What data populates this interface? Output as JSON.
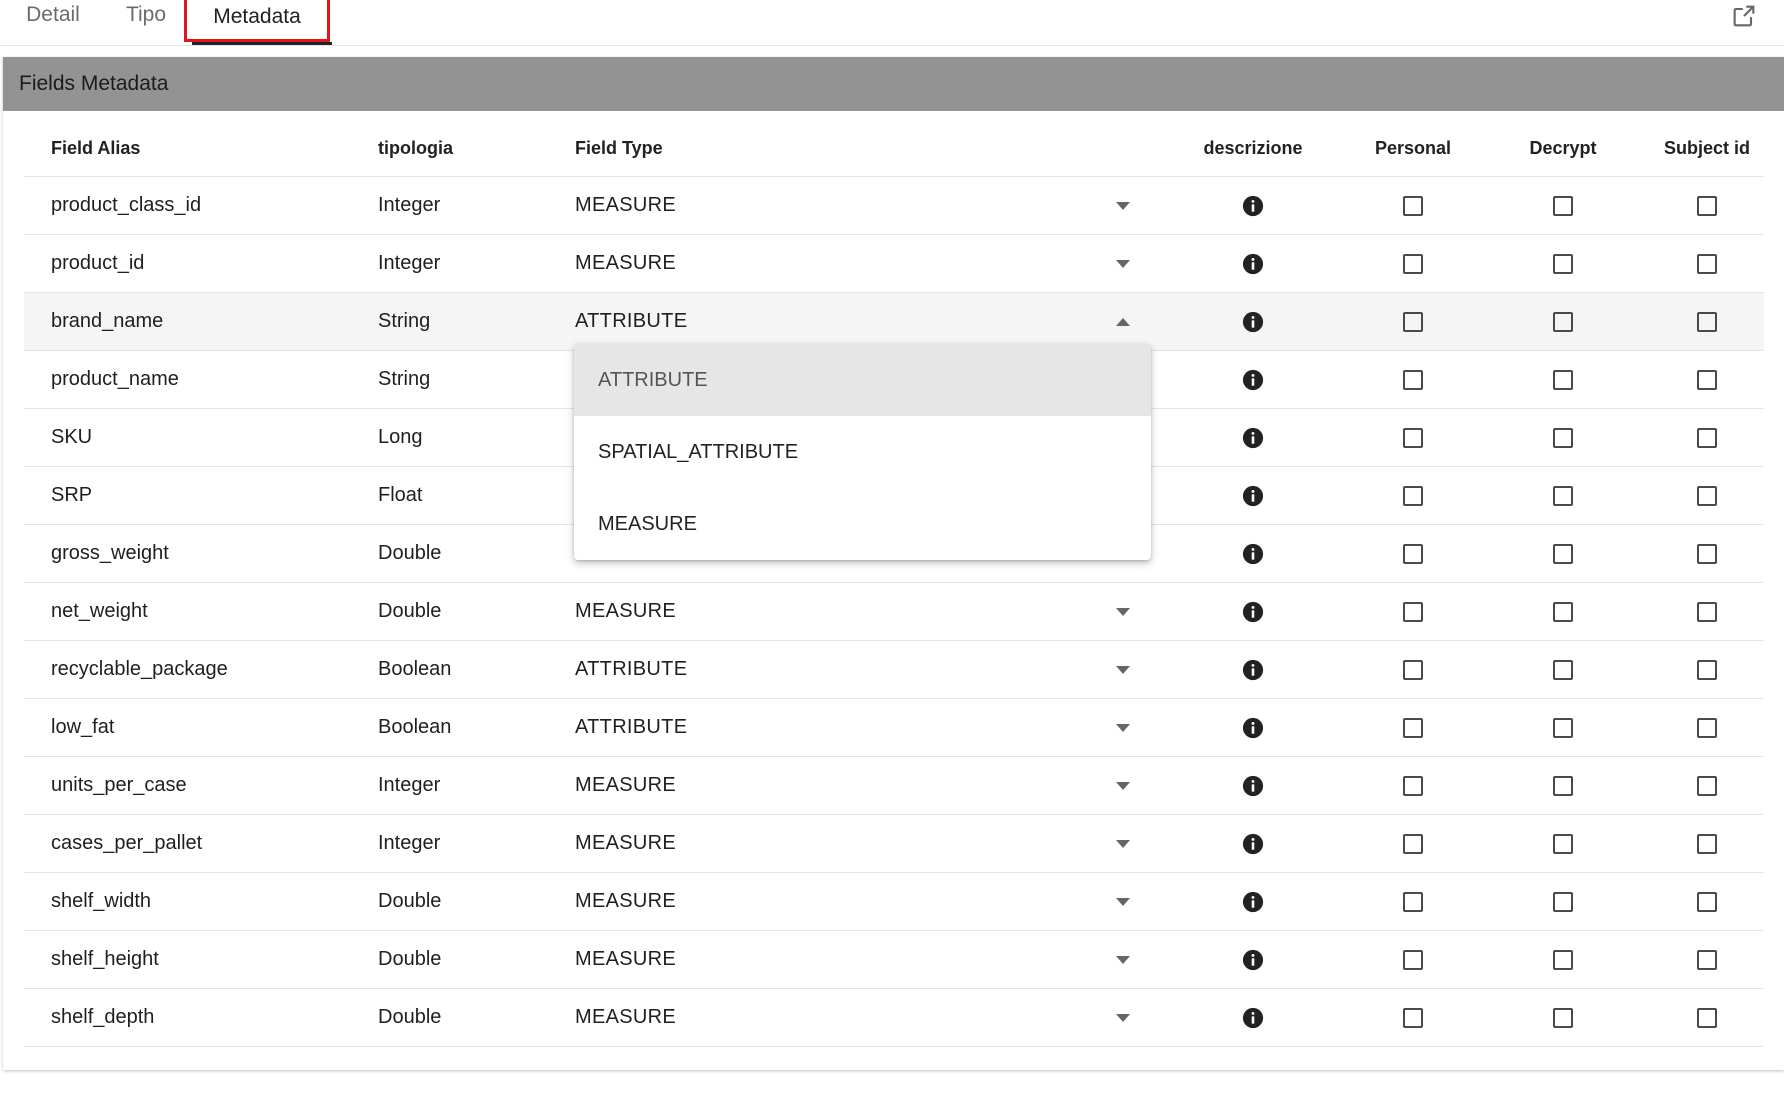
{
  "tabs": [
    {
      "label": "Detail"
    },
    {
      "label": "Tipo"
    },
    {
      "label": "Metadata"
    }
  ],
  "card_title": "Fields Metadata",
  "columns": {
    "alias": "Field Alias",
    "tipologia": "tipologia",
    "field_type": "Field Type",
    "descrizione": "descrizione",
    "personal": "Personal",
    "decrypt": "Decrypt",
    "subject_id": "Subject id"
  },
  "rows": [
    {
      "alias": "product_class_id",
      "tipologia": "Integer",
      "field_type": "MEASURE",
      "open": false
    },
    {
      "alias": "product_id",
      "tipologia": "Integer",
      "field_type": "MEASURE",
      "open": false
    },
    {
      "alias": "brand_name",
      "tipologia": "String",
      "field_type": "ATTRIBUTE",
      "open": true
    },
    {
      "alias": "product_name",
      "tipologia": "String",
      "field_type": "",
      "open": false
    },
    {
      "alias": "SKU",
      "tipologia": "Long",
      "field_type": "",
      "open": false
    },
    {
      "alias": "SRP",
      "tipologia": "Float",
      "field_type": "",
      "open": false
    },
    {
      "alias": "gross_weight",
      "tipologia": "Double",
      "field_type": "",
      "open": false
    },
    {
      "alias": "net_weight",
      "tipologia": "Double",
      "field_type": "MEASURE",
      "open": false
    },
    {
      "alias": "recyclable_package",
      "tipologia": "Boolean",
      "field_type": "ATTRIBUTE",
      "open": false
    },
    {
      "alias": "low_fat",
      "tipologia": "Boolean",
      "field_type": "ATTRIBUTE",
      "open": false
    },
    {
      "alias": "units_per_case",
      "tipologia": "Integer",
      "field_type": "MEASURE",
      "open": false
    },
    {
      "alias": "cases_per_pallet",
      "tipologia": "Integer",
      "field_type": "MEASURE",
      "open": false
    },
    {
      "alias": "shelf_width",
      "tipologia": "Double",
      "field_type": "MEASURE",
      "open": false
    },
    {
      "alias": "shelf_height",
      "tipologia": "Double",
      "field_type": "MEASURE",
      "open": false
    },
    {
      "alias": "shelf_depth",
      "tipologia": "Double",
      "field_type": "MEASURE",
      "open": false
    }
  ],
  "dropdown": {
    "options": [
      "ATTRIBUTE",
      "SPATIAL_ATTRIBUTE",
      "MEASURE"
    ],
    "selected": "ATTRIBUTE"
  },
  "colors": {
    "header_bg": "#939393",
    "active_tab_outline": "#e0161e"
  }
}
